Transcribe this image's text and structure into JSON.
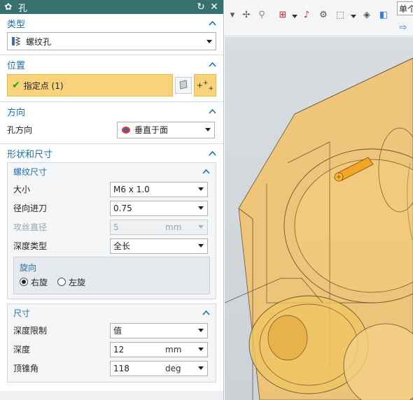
{
  "dialog": {
    "title": "孔"
  },
  "sections": {
    "type": {
      "title": "类型",
      "value": "螺纹孔"
    },
    "position": {
      "title": "位置",
      "point_label": "指定点 (1)"
    },
    "direction": {
      "title": "方向",
      "label": "孔方向",
      "value": "垂直于面"
    },
    "shape": {
      "title": "形状和尺寸",
      "thread": {
        "title": "螺纹尺寸",
        "size_label": "大小",
        "size_value": "M6 x 1.0",
        "radial_label": "径向进刀",
        "radial_value": "0.75",
        "tap_label": "攻丝直径",
        "tap_value": "5",
        "tap_unit": "mm",
        "depth_type_label": "深度类型",
        "depth_type_value": "全长",
        "rotation": {
          "title": "旋向",
          "right": "右旋",
          "left": "左旋",
          "selected": "right"
        }
      },
      "dimensions": {
        "title": "尺寸",
        "limit_label": "深度限制",
        "limit_value": "值",
        "depth_label": "深度",
        "depth_value": "12",
        "depth_unit": "mm",
        "angle_label": "顶锥角",
        "angle_value": "118",
        "angle_unit": "deg"
      }
    }
  },
  "toolbar": {
    "unit_text": "单个"
  },
  "icons": [
    "gear-icon",
    "reset-icon",
    "close-icon",
    "threaded-hole-icon",
    "check-icon",
    "sketch-plane-icon",
    "point-plus-icon",
    "direction-face-icon",
    "chevron-up-icon",
    "chevron-down-icon"
  ],
  "colors": {
    "titlebar": "#36706f",
    "section_title": "#1f6fa8",
    "highlight": "#f8d37a",
    "model": "#f0b23a"
  }
}
